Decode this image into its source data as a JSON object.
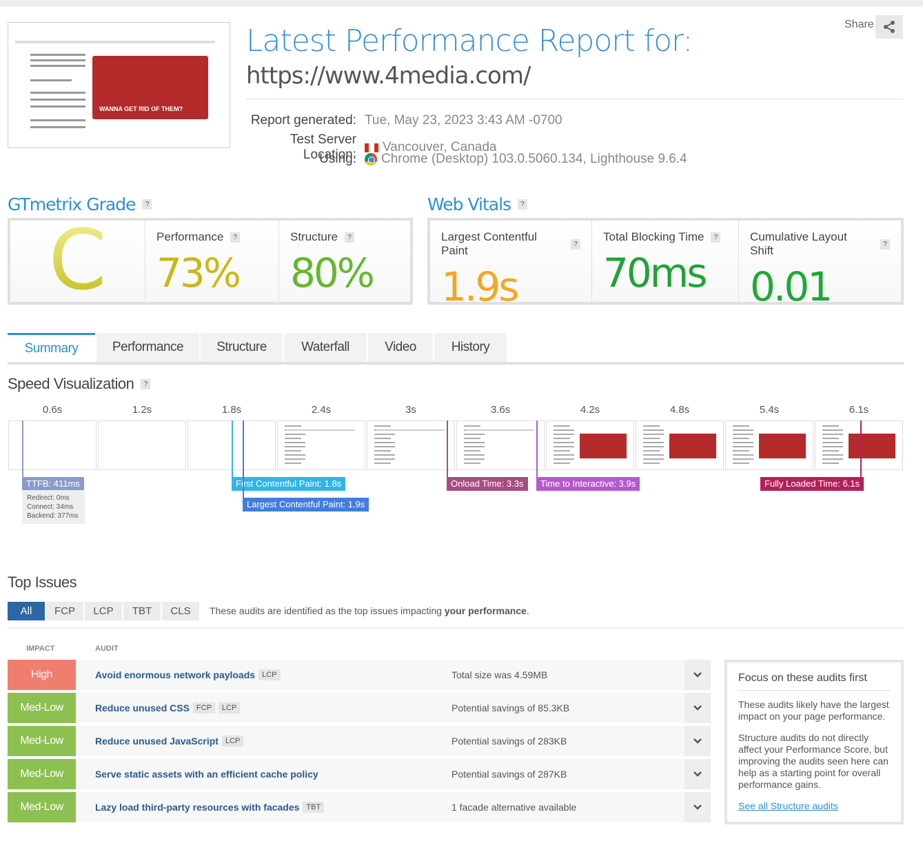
{
  "header": {
    "title": "Latest Performance Report for:",
    "url": "https://www.4media.com/",
    "share_label": "Share",
    "share_icon": "share-icon",
    "thumbnail_caption": "WANNA GET RID OF THEM?",
    "meta": [
      {
        "label": "Report generated:",
        "value": "Tue, May 23, 2023 3:43 AM -0700"
      },
      {
        "label": "Test Server Location:",
        "value": "Vancouver, Canada",
        "icon": "canada-flag-icon"
      },
      {
        "label": "Using:",
        "value": "Chrome (Desktop) 103.0.5060.134, Lighthouse 9.6.4",
        "icon": "chrome-icon"
      }
    ]
  },
  "grade": {
    "title": "GTmetrix Grade",
    "help": "?",
    "letter": "C",
    "performance_label": "Performance",
    "performance": "73%",
    "structure_label": "Structure",
    "structure": "80%"
  },
  "vitals": {
    "title": "Web Vitals",
    "help": "?",
    "items": [
      {
        "label": "Largest Contentful Paint",
        "value": "1.9s",
        "color": "#f5a623"
      },
      {
        "label": "Total Blocking Time",
        "value": "70ms",
        "color": "#21a336"
      },
      {
        "label": "Cumulative Layout Shift",
        "value": "0.01",
        "color": "#1fa838"
      }
    ]
  },
  "tabs": [
    "Summary",
    "Performance",
    "Structure",
    "Waterfall",
    "Video",
    "History"
  ],
  "speed": {
    "title": "Speed Visualization",
    "help": "?",
    "times": [
      "0.6s",
      "1.2s",
      "1.8s",
      "2.4s",
      "3s",
      "3.6s",
      "4.2s",
      "4.8s",
      "5.4s",
      "6.1s"
    ],
    "markers": {
      "ttfb": "TTFB: 411ms",
      "redirect": "Redirect: 0ms",
      "connect": "Connect: 34ms",
      "backend": "Backend: 377ms",
      "fcp": "First Contentful Paint: 1.8s",
      "lcp": "Largest Contentful Paint: 1.9s",
      "onload": "Onload Time: 3.3s",
      "tti": "Time to Interactive: 3.9s",
      "fully": "Fully Loaded Time: 6.1s"
    }
  },
  "issues": {
    "title": "Top Issues",
    "filters": [
      "All",
      "FCP",
      "LCP",
      "TBT",
      "CLS"
    ],
    "desc_prefix": "These audits are identified as the top issues impacting ",
    "desc_bold": "your performance",
    "desc_suffix": ".",
    "col_impact": "IMPACT",
    "col_audit": "AUDIT",
    "rows": [
      {
        "impact": "High",
        "color": "#f07e6e",
        "audit": "Avoid enormous network payloads",
        "tags": [
          "LCP"
        ],
        "detail": "Total size was 4.59MB"
      },
      {
        "impact": "Med-Low",
        "color": "#8cc152",
        "audit": "Reduce unused CSS",
        "tags": [
          "FCP",
          "LCP"
        ],
        "detail": "Potential savings of 85.3KB"
      },
      {
        "impact": "Med-Low",
        "color": "#8cc152",
        "audit": "Reduce unused JavaScript",
        "tags": [
          "LCP"
        ],
        "detail": "Potential savings of 283KB"
      },
      {
        "impact": "Med-Low",
        "color": "#8cc152",
        "audit": "Serve static assets with an efficient cache policy",
        "tags": [],
        "detail": "Potential savings of 287KB"
      },
      {
        "impact": "Med-Low",
        "color": "#8cc152",
        "audit": "Lazy load third-party resources with facades",
        "tags": [
          "TBT"
        ],
        "detail": "1 facade alternative available"
      }
    ]
  },
  "side": {
    "title": "Focus on these audits first",
    "p1": "These audits likely have the largest impact on your page performance.",
    "p2": "Structure audits do not directly affect your Performance Score, but improving the audits seen here can help as a starting point for overall performance gains.",
    "link": "See all Structure audits"
  }
}
